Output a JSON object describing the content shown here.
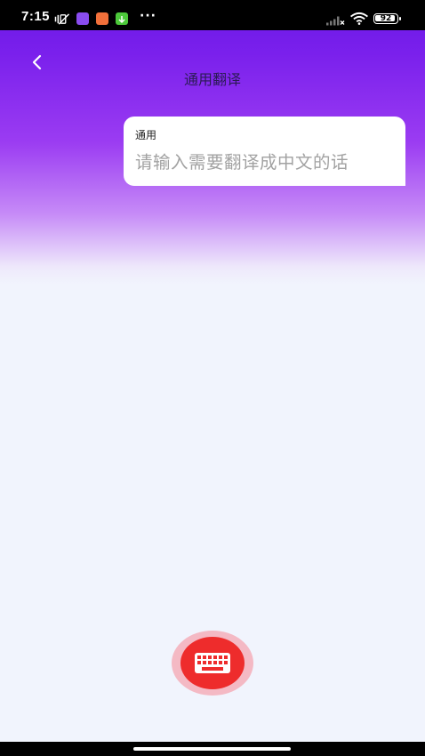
{
  "status_bar": {
    "time": "7:15",
    "battery": "92",
    "dots": "···",
    "icons": [
      "mute-vibrate-icon",
      "purple-app-icon",
      "orange-app-icon",
      "green-download-icon",
      "signal-icon",
      "wifi-icon",
      "battery-icon"
    ]
  },
  "header": {
    "title": "通用翻译",
    "back_icon": "chevron-left-icon"
  },
  "input_card": {
    "label": "通用",
    "placeholder": "请输入需要翻译成中文的话",
    "value": ""
  },
  "keyboard_button": {
    "icon": "keyboard-icon"
  },
  "colors": {
    "header_gradient_top": "#6a18e6",
    "header_gradient_bottom": "#c68af7",
    "background": "#f1f4fd",
    "keyboard_button": "#ee2c2c",
    "keyboard_halo": "#f4b9c4"
  }
}
